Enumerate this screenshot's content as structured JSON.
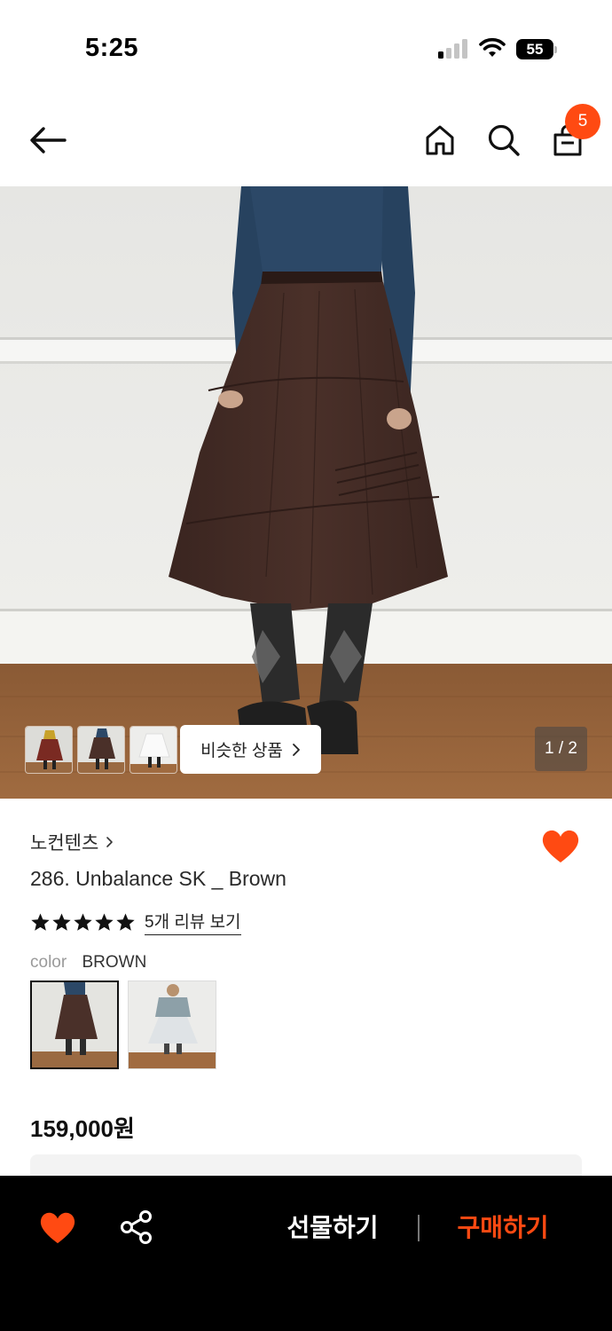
{
  "status_bar": {
    "time": "5:25",
    "battery": "55"
  },
  "header": {
    "cart_count": "5",
    "icons": [
      "back-arrow-icon",
      "home-icon",
      "search-icon",
      "shopping-bag-icon"
    ]
  },
  "gallery": {
    "page_indicator": "1 / 2",
    "similar_button_label": "비슷한 상품",
    "thumbnails": [
      "thumb-1",
      "thumb-2",
      "thumb-3"
    ]
  },
  "product": {
    "brand": "노컨텐츠",
    "name": "286. Unbalance SK _ Brown",
    "rating": 5,
    "review_link": "5개 리뷰 보기",
    "color_label": "color",
    "color_value": "BROWN",
    "price": "159,000원",
    "wishlisted": true
  },
  "bottom_bar": {
    "gift_label": "선물하기",
    "buy_label": "구매하기"
  },
  "colors": {
    "accent": "#ff4a12",
    "bottom_bar_bg": "#000000"
  }
}
